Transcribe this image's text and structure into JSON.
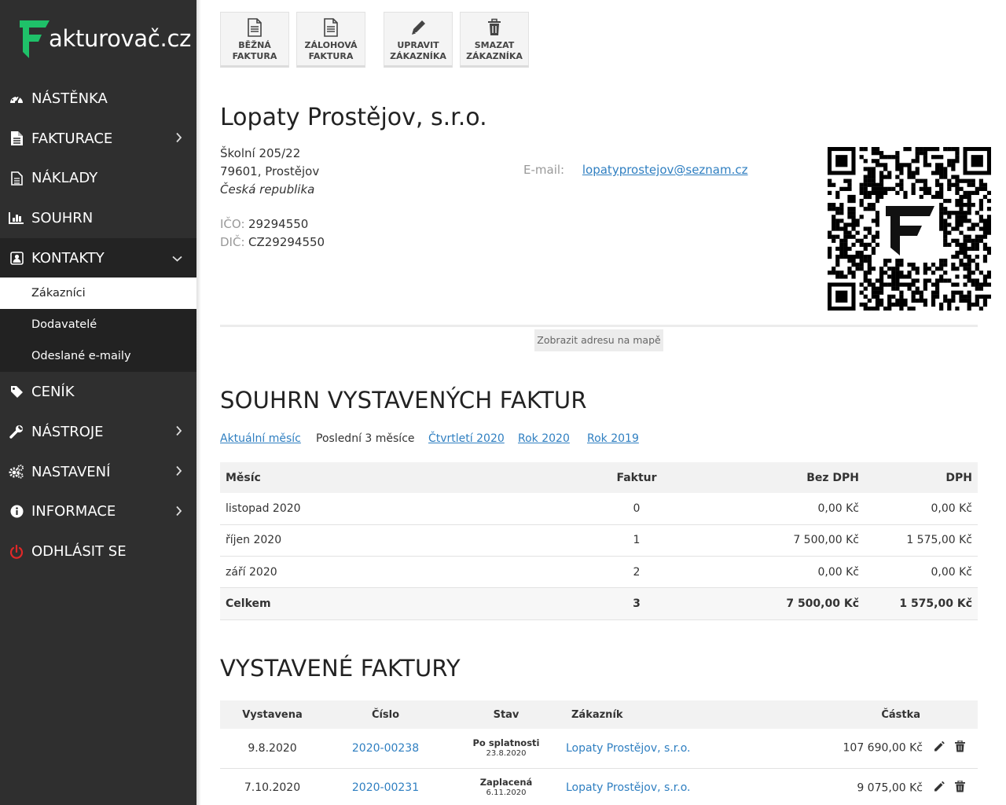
{
  "brand": {
    "logo_text": "akturovač.cz",
    "logo_color": "#1fc169"
  },
  "sidebar": {
    "items": [
      {
        "label": "NÁSTĚNKA",
        "icon": "dashboard-icon",
        "chevron": ""
      },
      {
        "label": "FAKTURACE",
        "icon": "invoice-icon",
        "chevron": "right"
      },
      {
        "label": "NÁKLADY",
        "icon": "document-icon",
        "chevron": ""
      },
      {
        "label": "SOUHRN",
        "icon": "bar-chart-icon",
        "chevron": ""
      },
      {
        "label": "KONTAKTY",
        "icon": "contact-card-icon",
        "chevron": "down"
      },
      {
        "label": "CENÍK",
        "icon": "tag-icon",
        "chevron": ""
      },
      {
        "label": "NÁSTROJE",
        "icon": "wrench-icon",
        "chevron": "right"
      },
      {
        "label": "NASTAVENÍ",
        "icon": "gears-icon",
        "chevron": "right"
      },
      {
        "label": "INFORMACE",
        "icon": "info-icon",
        "chevron": "right"
      },
      {
        "label": "ODHLÁSIT SE",
        "icon": "power-icon",
        "chevron": ""
      }
    ],
    "sub_items": [
      {
        "label": "Zákazníci",
        "active": true
      },
      {
        "label": "Dodavatelé",
        "active": false
      },
      {
        "label": "Odeslané e-maily",
        "active": false
      }
    ]
  },
  "toolbar": {
    "regular_invoice": "BĚŽNÁ\nFAKTURA",
    "advance_invoice": "ZÁLOHOVÁ\nFAKTURA",
    "edit_customer": "UPRAVIT\nZÁKAZNÍKA",
    "delete_customer": "SMAZAT\nZÁKAZNÍKA"
  },
  "customer": {
    "name": "Lopaty Prostějov, s.r.o.",
    "street": "Školní 205/22",
    "city": "79601, Prostějov",
    "country": "Česká republika",
    "ico_label": "IČO:",
    "ico": "29294550",
    "dic_label": "DIČ:",
    "dic": "CZ29294550",
    "email_label": "E-mail:",
    "email": "lopatyprostejov@seznam.cz",
    "map_button": "Zobrazit adresu na mapě"
  },
  "summary": {
    "title": "SOUHRN VYSTAVENÝCH FAKTUR",
    "periods": [
      {
        "label": "Aktuální měsíc",
        "current": false
      },
      {
        "label": "Poslední 3 měsíce",
        "current": true
      },
      {
        "label": "Čtvrtletí 2020",
        "current": false
      },
      {
        "label": "Rok 2020",
        "current": false
      },
      {
        "label": "Rok 2019",
        "current": false
      }
    ],
    "columns": {
      "month": "Měsíc",
      "count": "Faktur",
      "net": "Bez DPH",
      "vat": "DPH"
    },
    "rows": [
      {
        "month": "listopad 2020",
        "count": "0",
        "net": "0,00 Kč",
        "vat": "0,00 Kč"
      },
      {
        "month": "říjen 2020",
        "count": "1",
        "net": "7 500,00 Kč",
        "vat": "1 575,00 Kč"
      },
      {
        "month": "září 2020",
        "count": "2",
        "net": "0,00 Kč",
        "vat": "0,00 Kč"
      }
    ],
    "total": {
      "month": "Celkem",
      "count": "3",
      "net": "7 500,00 Kč",
      "vat": "1 575,00 Kč"
    }
  },
  "invoices": {
    "title": "VYSTAVENÉ FAKTURY",
    "columns": {
      "issued": "Vystavena",
      "number": "Číslo",
      "status": "Stav",
      "customer": "Zákazník",
      "amount": "Částka"
    },
    "rows": [
      {
        "issued": "9.8.2020",
        "number": "2020-00238",
        "status": "Po splatnosti",
        "status_date": "23.8.2020",
        "status_type": "overdue",
        "customer": "Lopaty Prostějov, s.r.o.",
        "amount": "107 690,00 Kč"
      },
      {
        "issued": "7.10.2020",
        "number": "2020-00231",
        "status": "Zaplacená",
        "status_date": "6.11.2020",
        "status_type": "paid",
        "customer": "Lopaty Prostějov, s.r.o.",
        "amount": "9 075,00 Kč"
      }
    ]
  }
}
